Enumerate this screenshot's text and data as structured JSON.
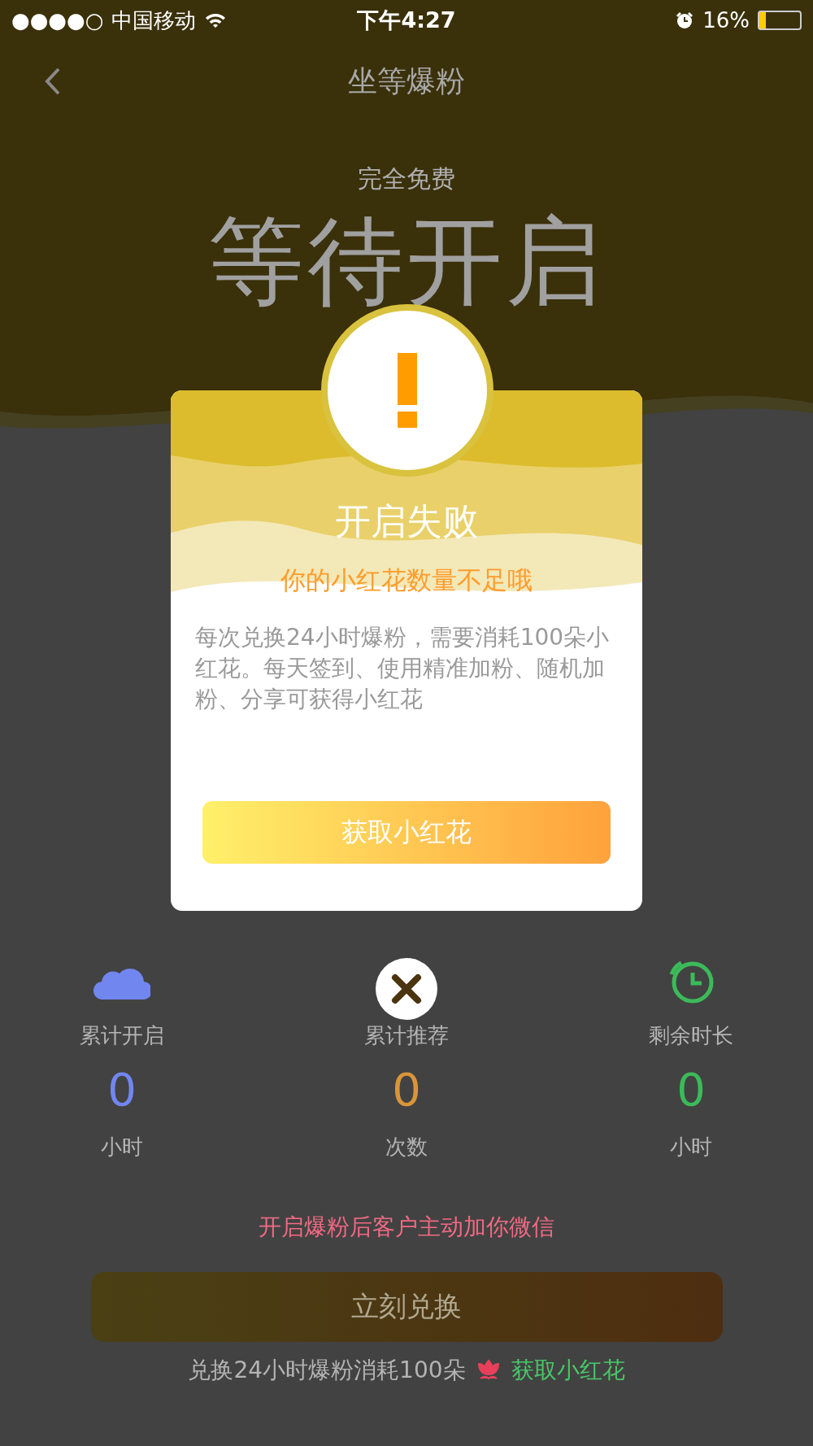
{
  "status_bar": {
    "signal": "●●●●○",
    "carrier": "中国移动",
    "time": "下午4:27",
    "battery": "16%"
  },
  "nav": {
    "title": "坐等爆粉"
  },
  "hero": {
    "subtitle": "完全免费",
    "status": "等待开启"
  },
  "stats": [
    {
      "kind": "cloud",
      "label": "累计开启",
      "value": "0",
      "unit": "小时",
      "color": "#7286f0"
    },
    {
      "kind": "ring",
      "label": "累计推荐",
      "value": "0",
      "unit": "次数",
      "color": "#d8953a"
    },
    {
      "kind": "clock",
      "label": "剩余时长",
      "value": "0",
      "unit": "小时",
      "color": "#3cba5a"
    }
  ],
  "notice": "开启爆粉后客户主动加你微信",
  "primary_button": "立刻兑换",
  "footer": {
    "text": "兑换24小时爆粉消耗100朵",
    "link": "获取小红花"
  },
  "dialog": {
    "title": "开启失败",
    "subtitle": "你的小红花数量不足哦",
    "body": "每次兑换24小时爆粉，需要消耗100朵小红花。每天签到、使用精准加粉、随机加粉、分享可获得小红花",
    "button": "获取小红花"
  }
}
